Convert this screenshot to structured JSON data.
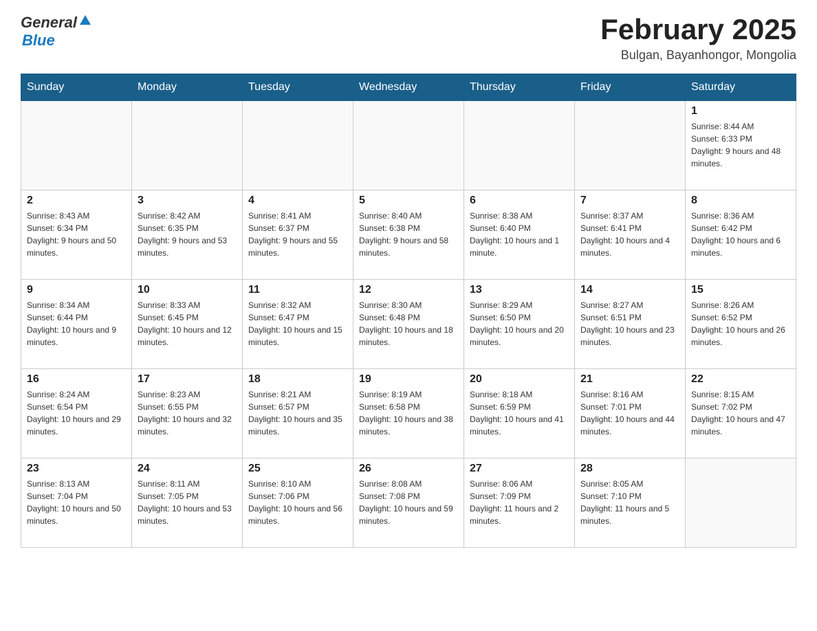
{
  "logo": {
    "text_general": "General",
    "text_blue": "Blue"
  },
  "title": "February 2025",
  "subtitle": "Bulgan, Bayanhongor, Mongolia",
  "weekdays": [
    "Sunday",
    "Monday",
    "Tuesday",
    "Wednesday",
    "Thursday",
    "Friday",
    "Saturday"
  ],
  "weeks": [
    [
      {
        "day": "",
        "info": ""
      },
      {
        "day": "",
        "info": ""
      },
      {
        "day": "",
        "info": ""
      },
      {
        "day": "",
        "info": ""
      },
      {
        "day": "",
        "info": ""
      },
      {
        "day": "",
        "info": ""
      },
      {
        "day": "1",
        "info": "Sunrise: 8:44 AM\nSunset: 6:33 PM\nDaylight: 9 hours and 48 minutes."
      }
    ],
    [
      {
        "day": "2",
        "info": "Sunrise: 8:43 AM\nSunset: 6:34 PM\nDaylight: 9 hours and 50 minutes."
      },
      {
        "day": "3",
        "info": "Sunrise: 8:42 AM\nSunset: 6:35 PM\nDaylight: 9 hours and 53 minutes."
      },
      {
        "day": "4",
        "info": "Sunrise: 8:41 AM\nSunset: 6:37 PM\nDaylight: 9 hours and 55 minutes."
      },
      {
        "day": "5",
        "info": "Sunrise: 8:40 AM\nSunset: 6:38 PM\nDaylight: 9 hours and 58 minutes."
      },
      {
        "day": "6",
        "info": "Sunrise: 8:38 AM\nSunset: 6:40 PM\nDaylight: 10 hours and 1 minute."
      },
      {
        "day": "7",
        "info": "Sunrise: 8:37 AM\nSunset: 6:41 PM\nDaylight: 10 hours and 4 minutes."
      },
      {
        "day": "8",
        "info": "Sunrise: 8:36 AM\nSunset: 6:42 PM\nDaylight: 10 hours and 6 minutes."
      }
    ],
    [
      {
        "day": "9",
        "info": "Sunrise: 8:34 AM\nSunset: 6:44 PM\nDaylight: 10 hours and 9 minutes."
      },
      {
        "day": "10",
        "info": "Sunrise: 8:33 AM\nSunset: 6:45 PM\nDaylight: 10 hours and 12 minutes."
      },
      {
        "day": "11",
        "info": "Sunrise: 8:32 AM\nSunset: 6:47 PM\nDaylight: 10 hours and 15 minutes."
      },
      {
        "day": "12",
        "info": "Sunrise: 8:30 AM\nSunset: 6:48 PM\nDaylight: 10 hours and 18 minutes."
      },
      {
        "day": "13",
        "info": "Sunrise: 8:29 AM\nSunset: 6:50 PM\nDaylight: 10 hours and 20 minutes."
      },
      {
        "day": "14",
        "info": "Sunrise: 8:27 AM\nSunset: 6:51 PM\nDaylight: 10 hours and 23 minutes."
      },
      {
        "day": "15",
        "info": "Sunrise: 8:26 AM\nSunset: 6:52 PM\nDaylight: 10 hours and 26 minutes."
      }
    ],
    [
      {
        "day": "16",
        "info": "Sunrise: 8:24 AM\nSunset: 6:54 PM\nDaylight: 10 hours and 29 minutes."
      },
      {
        "day": "17",
        "info": "Sunrise: 8:23 AM\nSunset: 6:55 PM\nDaylight: 10 hours and 32 minutes."
      },
      {
        "day": "18",
        "info": "Sunrise: 8:21 AM\nSunset: 6:57 PM\nDaylight: 10 hours and 35 minutes."
      },
      {
        "day": "19",
        "info": "Sunrise: 8:19 AM\nSunset: 6:58 PM\nDaylight: 10 hours and 38 minutes."
      },
      {
        "day": "20",
        "info": "Sunrise: 8:18 AM\nSunset: 6:59 PM\nDaylight: 10 hours and 41 minutes."
      },
      {
        "day": "21",
        "info": "Sunrise: 8:16 AM\nSunset: 7:01 PM\nDaylight: 10 hours and 44 minutes."
      },
      {
        "day": "22",
        "info": "Sunrise: 8:15 AM\nSunset: 7:02 PM\nDaylight: 10 hours and 47 minutes."
      }
    ],
    [
      {
        "day": "23",
        "info": "Sunrise: 8:13 AM\nSunset: 7:04 PM\nDaylight: 10 hours and 50 minutes."
      },
      {
        "day": "24",
        "info": "Sunrise: 8:11 AM\nSunset: 7:05 PM\nDaylight: 10 hours and 53 minutes."
      },
      {
        "day": "25",
        "info": "Sunrise: 8:10 AM\nSunset: 7:06 PM\nDaylight: 10 hours and 56 minutes."
      },
      {
        "day": "26",
        "info": "Sunrise: 8:08 AM\nSunset: 7:08 PM\nDaylight: 10 hours and 59 minutes."
      },
      {
        "day": "27",
        "info": "Sunrise: 8:06 AM\nSunset: 7:09 PM\nDaylight: 11 hours and 2 minutes."
      },
      {
        "day": "28",
        "info": "Sunrise: 8:05 AM\nSunset: 7:10 PM\nDaylight: 11 hours and 5 minutes."
      },
      {
        "day": "",
        "info": ""
      }
    ]
  ]
}
